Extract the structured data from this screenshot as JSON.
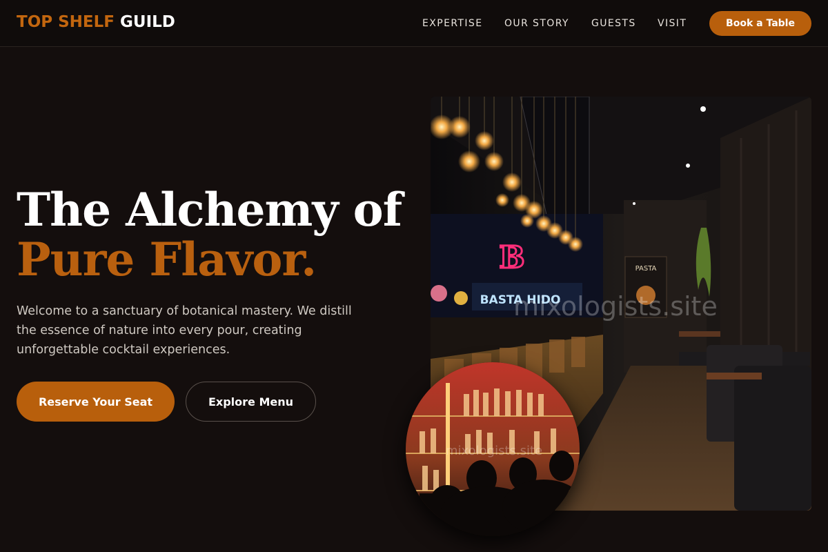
{
  "header": {
    "logo_accent": "TOP SHELF",
    "logo_rest": "GUILD",
    "nav": [
      "EXPERTISE",
      "OUR STORY",
      "GUESTS",
      "VISIT"
    ],
    "cta": "Book a Table"
  },
  "hero": {
    "title_line1": "The Alchemy of",
    "title_line2": "Pure Flavor.",
    "description": "Welcome to a sanctuary of botanical mastery. We distill the essence of nature into every pour, creating unforgettable cocktail experiences.",
    "primary_button": "Reserve Your Seat",
    "secondary_button": "Explore Menu"
  },
  "images": {
    "main_watermark": "mixologists.site",
    "circle_watermark": "mixologists.site",
    "sign_b": "B",
    "sign_pasta": "BASTA HIDO",
    "poster_title": "PASTA"
  },
  "colors": {
    "accent": "#b85f0c",
    "background": "#140e0d"
  }
}
